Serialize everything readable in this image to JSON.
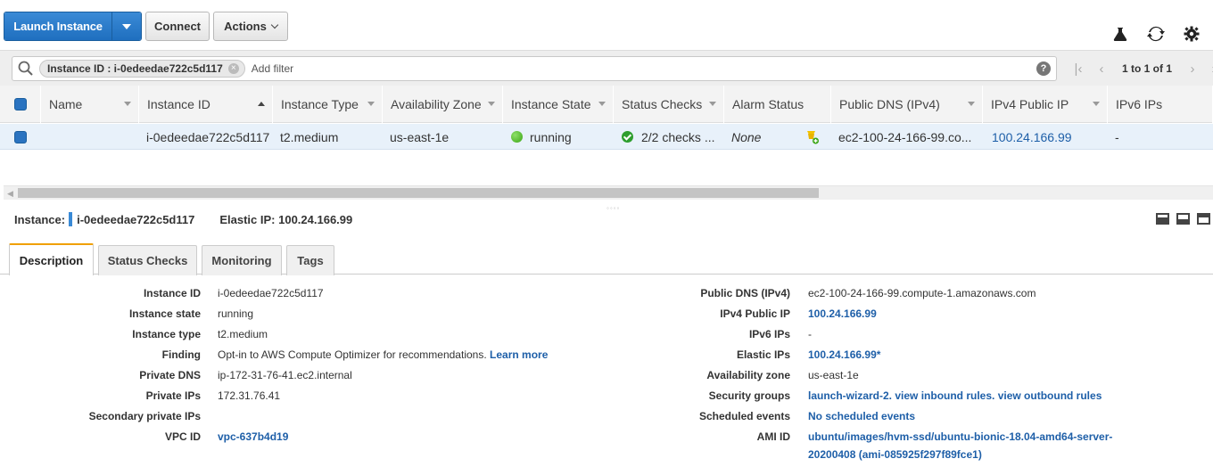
{
  "toolbar": {
    "launch_label": "Launch Instance",
    "connect_label": "Connect",
    "actions_label": "Actions"
  },
  "filter": {
    "chip_label": "Instance ID : i-0edeedae722c5d117",
    "add_filter": "Add filter",
    "help": "?",
    "pager_text": "1 to 1 of 1"
  },
  "table": {
    "columns": [
      "Name",
      "Instance ID",
      "Instance Type",
      "Availability Zone",
      "Instance State",
      "Status Checks",
      "Alarm Status",
      "Public DNS (IPv4)",
      "IPv4 Public IP",
      "IPv6 IPs"
    ],
    "row": {
      "name": "",
      "instance_id": "i-0edeedae722c5d117",
      "instance_type": "t2.medium",
      "az": "us-east-1e",
      "state": "running",
      "status_checks": "2/2 checks ...",
      "alarm_status": "None",
      "public_dns": "ec2-100-24-166-99.co...",
      "public_ip": "100.24.166.99",
      "ipv6": "-"
    }
  },
  "detail": {
    "instance_label": "Instance:",
    "instance_id": "i-0edeedae722c5d117",
    "elastic_label": "Elastic IP: 100.24.166.99",
    "tabs": [
      "Description",
      "Status Checks",
      "Monitoring",
      "Tags"
    ],
    "left": [
      {
        "label": "Instance ID",
        "value": "i-0edeedae722c5d117"
      },
      {
        "label": "Instance state",
        "value": "running"
      },
      {
        "label": "Instance type",
        "value": "t2.medium"
      },
      {
        "label": "Finding",
        "value": "Opt-in to AWS Compute Optimizer for recommendations.",
        "link": "Learn more"
      },
      {
        "label": "Private DNS",
        "value": "ip-172-31-76-41.ec2.internal"
      },
      {
        "label": "Private IPs",
        "value": "172.31.76.41"
      },
      {
        "label": "Secondary private IPs",
        "value": ""
      },
      {
        "label": "VPC ID",
        "value": "vpc-637b4d19"
      }
    ],
    "right": [
      {
        "label": "Public DNS (IPv4)",
        "value": "ec2-100-24-166-99.compute-1.amazonaws.com"
      },
      {
        "label": "IPv4 Public IP",
        "value": "100.24.166.99"
      },
      {
        "label": "IPv6 IPs",
        "value": "-"
      },
      {
        "label": "Elastic IPs",
        "value": "100.24.166.99*"
      },
      {
        "label": "Availability zone",
        "value": "us-east-1e"
      },
      {
        "label": "Security groups",
        "value": "launch-wizard-2. view inbound rules. view outbound rules"
      },
      {
        "label": "Scheduled events",
        "value": "No scheduled events"
      },
      {
        "label": "AMI ID",
        "value": "ubuntu/images/hvm-ssd/ubuntu-bionic-18.04-amd64-server-",
        "value2": "20200408 (ami-085925f297f89fce1)"
      }
    ]
  }
}
